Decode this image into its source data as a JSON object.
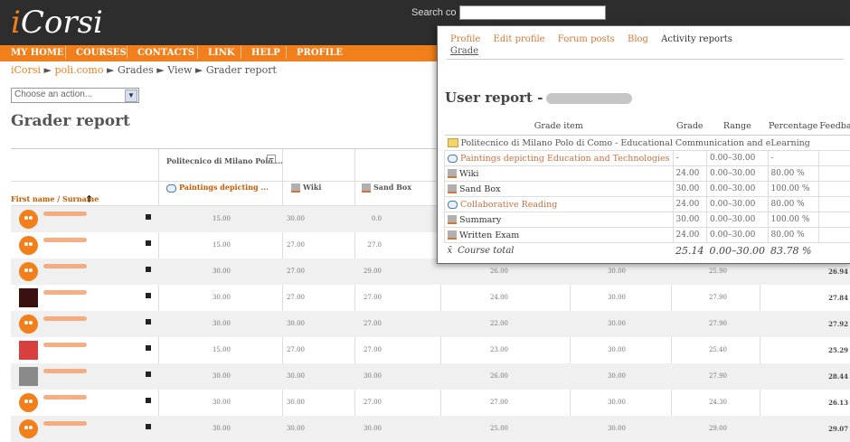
{
  "app": {
    "logo": "Corsi",
    "logo_prefix": "i",
    "search_label": "Search co"
  },
  "nav": {
    "items": [
      "MY HOME",
      "COURSES",
      "CONTACTS",
      "LINK",
      "HELP",
      "PROFILE"
    ]
  },
  "breadcrumb": {
    "site": "iCorsi",
    "course": "poli.como",
    "rest": "► Grades ► View ► Grader report"
  },
  "action_select": {
    "value": "Choose an action..."
  },
  "page_title": "Grader report",
  "grader": {
    "category_header": "Politecnico di Milano Polo ...",
    "name_header": "First name / Surname",
    "item_headers": [
      "Paintings depicting ...",
      "Wiki",
      "Sand Box"
    ],
    "rows": [
      [
        "15.00",
        "30.00",
        "0.0"
      ],
      [
        "15.00",
        "27.00",
        "27.0"
      ],
      [
        "30.00",
        "27.00",
        "29.00",
        "26.00",
        "30.00",
        "25.90",
        "26.94"
      ],
      [
        "30.00",
        "27.00",
        "27.00",
        "24.00",
        "30.00",
        "27.90",
        "27.84"
      ],
      [
        "30.00",
        "30.00",
        "27.00",
        "22.00",
        "30.00",
        "27.90",
        "27.92"
      ],
      [
        "15.00",
        "27.00",
        "27.00",
        "23.00",
        "30.00",
        "25.40",
        "25.29"
      ],
      [
        "30.00",
        "30.00",
        "30.00",
        "26.00",
        "30.00",
        "27.90",
        "28.44"
      ],
      [
        "30.00",
        "30.00",
        "27.00",
        "27.00",
        "30.00",
        "24.30",
        "26.13"
      ],
      [
        "30.00",
        "30.00",
        "30.00",
        "25.00",
        "30.00",
        "29.00",
        "29.07"
      ]
    ]
  },
  "report": {
    "tabs": [
      "Profile",
      "Edit profile",
      "Forum posts",
      "Blog",
      "Activity reports"
    ],
    "grade_tab": "Grade",
    "title": "User report -",
    "columns": [
      "Grade item",
      "Grade",
      "Range",
      "Percentage",
      "Feedback"
    ],
    "category": "Politecnico di Milano Polo di Como - Educational Communication and eLearning",
    "items": [
      {
        "name": "Paintings depicting Education and Technologies",
        "grade": "-",
        "range": "0.00–30.00",
        "pct": "-",
        "icon": "forum",
        "link": true
      },
      {
        "name": "Wiki",
        "grade": "24.00",
        "range": "0.00–30.00",
        "pct": "80.00 %",
        "icon": "quiz",
        "link": false
      },
      {
        "name": "Sand Box",
        "grade": "30.00",
        "range": "0.00–30.00",
        "pct": "100.00 %",
        "icon": "quiz",
        "link": false
      },
      {
        "name": "Collaborative Reading",
        "grade": "24.00",
        "range": "0.00–30.00",
        "pct": "80.00 %",
        "icon": "forum",
        "link": true
      },
      {
        "name": "Summary",
        "grade": "30.00",
        "range": "0.00–30.00",
        "pct": "100.00 %",
        "icon": "quiz",
        "link": false
      },
      {
        "name": "Written Exam",
        "grade": "24.00",
        "range": "0.00–30.00",
        "pct": "80.00 %",
        "icon": "quiz",
        "link": false
      }
    ],
    "total": {
      "label": "Course total",
      "symbol": "x̄",
      "grade": "25.14",
      "range": "0.00–30.00",
      "pct": "83.78 %"
    }
  }
}
